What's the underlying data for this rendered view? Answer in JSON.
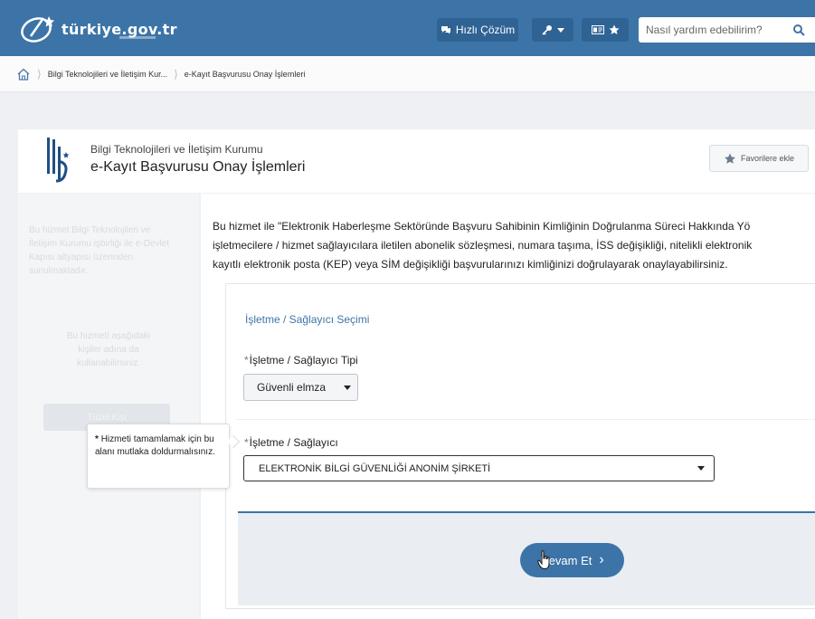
{
  "topbar": {
    "logo_text": "türkiye.gov.tr",
    "quick_solution_label": "Hızlı Çözüm",
    "search_placeholder": "Nasıl yardım edebilirim?"
  },
  "breadcrumb": {
    "items": [
      "Bilgi Teknolojileri ve İletişim Kur...",
      "e-Kayıt Başvurusu Onay İşlemleri"
    ]
  },
  "header": {
    "institution": "Bilgi Teknolojileri ve İletişim Kurumu",
    "title": "e-Kayıt Başvurusu Onay İşlemleri",
    "favorite_label": "Favorilere ekle"
  },
  "sidebar": {
    "paragraph1": "Bu hizmet Bilgi Teknolojileri ve İletişim Kurumu işbirliği ile e-Devlet Kapısı altyapısı üzerinden sunulmaktadır.",
    "paragraph2": "Bu hizmeti aşağıdaki kişiler adına da kullanabilirsiniz.",
    "button_label": "Tüzel Kişi"
  },
  "main": {
    "description_lines": [
      "Bu hizmet ile \"Elektronik Haberleşme Sektöründe Başvuru Sahibinin Kimliğinin Doğrulanma Süreci Hakkında Yö",
      "işletmecilere / hizmet sağlayıcılara iletilen abonelik sözleşmesi, numara taşıma, İSS değişikliği, nitelikli elektronik",
      "kayıtlı elektronik posta (KEP) veya SİM değişikliği başvurularınızı kimliğinizi doğrulayarak onaylayabilirsiniz."
    ],
    "section_title": "İşletme / Sağlayıcı Seçimi",
    "field1_label": "İşletme / Sağlayıcı Tipi",
    "field1_value": "Güvenli elmza",
    "field2_label": "İşletme / Sağlayıcı",
    "field2_value": "ELEKTRONİK BİLGİ GÜVENLİĞİ ANONİM ŞİRKETİ",
    "required_mark": "*",
    "tooltip_text": "Hizmeti tamamlamak için bu alanı mutlaka doldurmalısınız.",
    "continue_label": "Devam Et"
  },
  "colors": {
    "brand_blue": "#3d74a8",
    "topbar_button": "#2f6394"
  }
}
